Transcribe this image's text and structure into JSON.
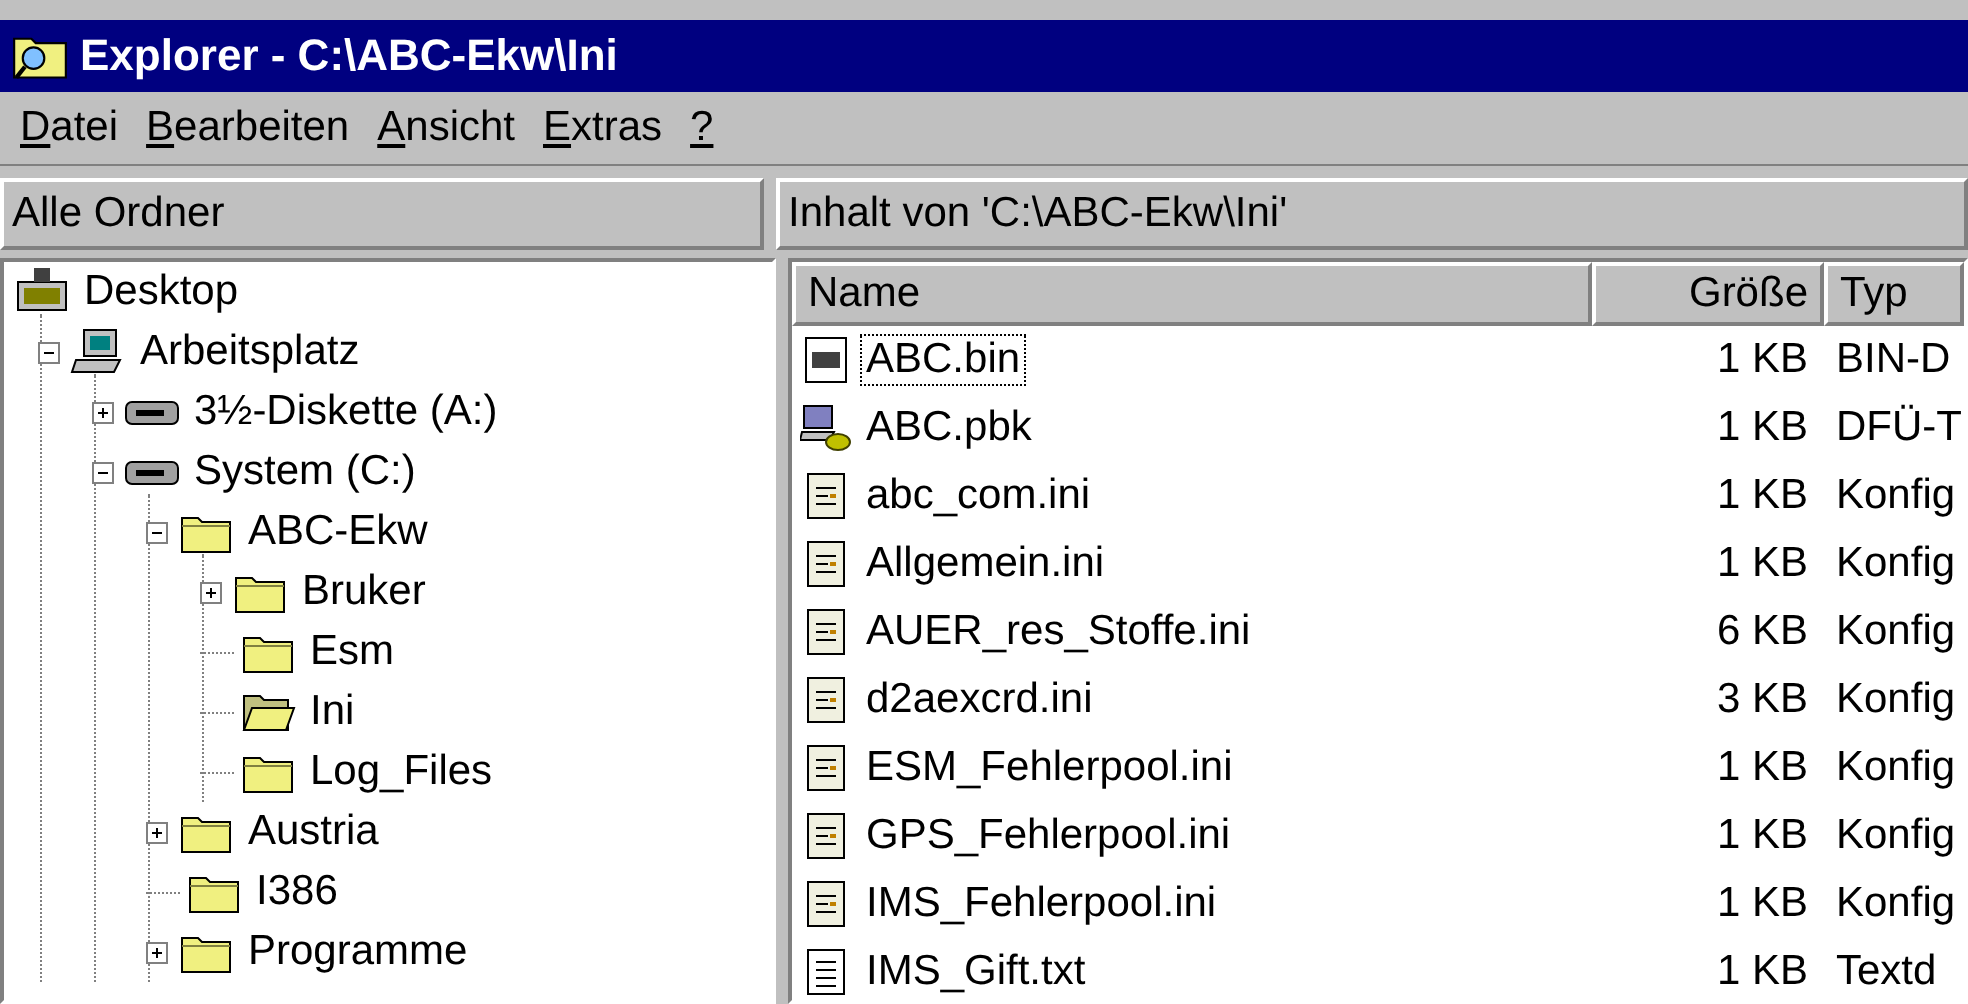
{
  "window": {
    "title": "Explorer - C:\\ABC-Ekw\\Ini"
  },
  "menu": [
    {
      "accel": "D",
      "rest": "atei"
    },
    {
      "accel": "B",
      "rest": "earbeiten"
    },
    {
      "accel": "A",
      "rest": "nsicht"
    },
    {
      "accel": "E",
      "rest": "xtras"
    },
    {
      "accel": "?"
    }
  ],
  "left_header": "Alle Ordner",
  "right_header": "Inhalt von 'C:\\ABC-Ekw\\Ini'",
  "tree": [
    {
      "label": "Desktop",
      "kind": "desktop",
      "children": [
        {
          "label": "Arbeitsplatz",
          "kind": "computer",
          "expanded": true,
          "children": [
            {
              "label": "3½-Diskette (A:)",
              "kind": "drive",
              "expanded": false
            },
            {
              "label": "System (C:)",
              "kind": "drive",
              "expanded": true,
              "children": [
                {
                  "label": "ABC-Ekw",
                  "kind": "folder",
                  "expanded": true,
                  "children": [
                    {
                      "label": "Bruker",
                      "kind": "folder",
                      "expanded": false
                    },
                    {
                      "label": "Esm",
                      "kind": "folder"
                    },
                    {
                      "label": "Ini",
                      "kind": "folder",
                      "open": true
                    },
                    {
                      "label": "Log_Files",
                      "kind": "folder"
                    }
                  ]
                },
                {
                  "label": "Austria",
                  "kind": "folder",
                  "expanded": false
                },
                {
                  "label": "I386",
                  "kind": "folder"
                },
                {
                  "label": "Programme",
                  "kind": "folder",
                  "expanded": false
                }
              ]
            }
          ]
        }
      ]
    }
  ],
  "columns": [
    "Name",
    "Größe",
    "Typ"
  ],
  "files": [
    {
      "name": "ABC.bin",
      "size": "1 KB",
      "type": "BIN-D",
      "kind": "bin",
      "focused": true
    },
    {
      "name": "ABC.pbk",
      "size": "1 KB",
      "type": "DFÜ-T",
      "kind": "phonebook",
      "focused": false
    },
    {
      "name": "abc_com.ini",
      "size": "1 KB",
      "type": "Konfig",
      "kind": "ini",
      "focused": false
    },
    {
      "name": "Allgemein.ini",
      "size": "1 KB",
      "type": "Konfig",
      "kind": "ini",
      "focused": false
    },
    {
      "name": "AUER_res_Stoffe.ini",
      "size": "6 KB",
      "type": "Konfig",
      "kind": "ini",
      "focused": false
    },
    {
      "name": "d2aexcrd.ini",
      "size": "3 KB",
      "type": "Konfig",
      "kind": "ini",
      "focused": false
    },
    {
      "name": "ESM_Fehlerpool.ini",
      "size": "1 KB",
      "type": "Konfig",
      "kind": "ini",
      "focused": false
    },
    {
      "name": "GPS_Fehlerpool.ini",
      "size": "1 KB",
      "type": "Konfig",
      "kind": "ini",
      "focused": false
    },
    {
      "name": "IMS_Fehlerpool.ini",
      "size": "1 KB",
      "type": "Konfig",
      "kind": "ini",
      "focused": false
    },
    {
      "name": "IMS_Gift.txt",
      "size": "1 KB",
      "type": "Textd",
      "kind": "txt",
      "focused": false
    }
  ]
}
